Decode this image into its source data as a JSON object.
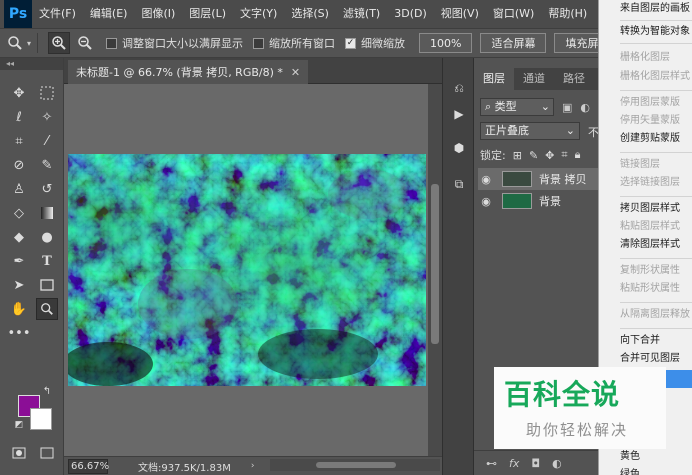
{
  "app": {
    "logo": "Ps"
  },
  "menubar": {
    "items": [
      "文件(F)",
      "编辑(E)",
      "图像(I)",
      "图层(L)",
      "文字(Y)",
      "选择(S)",
      "滤镜(T)",
      "3D(D)",
      "视图(V)",
      "窗口(W)",
      "帮助(H)"
    ]
  },
  "options": {
    "resize_windows_label": "调整窗口大小以满屏显示",
    "zoom_all_label": "缩放所有窗口",
    "scrubby_zoom_label": "细微缩放",
    "scrubby_zoom_checked": true,
    "btn_100": "100%",
    "btn_fit": "适合屏幕",
    "btn_fill": "填充屏幕"
  },
  "document": {
    "tab_title": "未标题-1 @ 66.7% (背景 拷贝, RGB/8) *",
    "zoom": "66.67%",
    "doc_info": "文档:937.5K/1.83M"
  },
  "colors": {
    "foreground": "#8b0e96",
    "background": "#ffffff",
    "canvas_tint": "#1f8f4a"
  },
  "layers_panel": {
    "tabs": [
      "图层",
      "通道",
      "路径"
    ],
    "filter_label": "类型",
    "blend_mode": "正片叠底",
    "opacity_label": "不",
    "lock_label": "锁定:",
    "layers": [
      {
        "name": "背景 拷贝",
        "selected": true
      },
      {
        "name": "背景",
        "selected": false
      }
    ],
    "footer": {
      "fx": "fx"
    }
  },
  "context_menu": {
    "items": [
      {
        "label": "来自图层的画板",
        "disabled": false
      },
      {
        "label": "转换为智能对象",
        "disabled": false
      },
      {
        "label": "栅格化图层",
        "disabled": true
      },
      {
        "label": "栅格化图层样式",
        "disabled": true
      },
      {
        "label": "停用图层蒙版",
        "disabled": true
      },
      {
        "label": "停用矢量蒙版",
        "disabled": true
      },
      {
        "label": "创建剪贴蒙版",
        "disabled": false
      },
      {
        "label": "链接图层",
        "disabled": true
      },
      {
        "label": "选择链接图层",
        "disabled": true
      },
      {
        "label": "拷贝图层样式",
        "disabled": false
      },
      {
        "label": "粘贴图层样式",
        "disabled": true
      },
      {
        "label": "清除图层样式",
        "disabled": false
      },
      {
        "label": "复制形状属性",
        "disabled": true
      },
      {
        "label": "粘贴形状属性",
        "disabled": true
      },
      {
        "label": "从隔离图层释放",
        "disabled": true
      },
      {
        "label": "向下合并",
        "disabled": false
      },
      {
        "label": "合并可见图层",
        "disabled": false
      },
      {
        "label": "",
        "disabled": false,
        "highlight": true
      },
      {
        "label": "黄色",
        "disabled": false
      },
      {
        "label": "绿色",
        "disabled": false
      }
    ]
  },
  "watermark": {
    "logo_text": "百科全说",
    "subtitle": "助你轻松解决"
  }
}
